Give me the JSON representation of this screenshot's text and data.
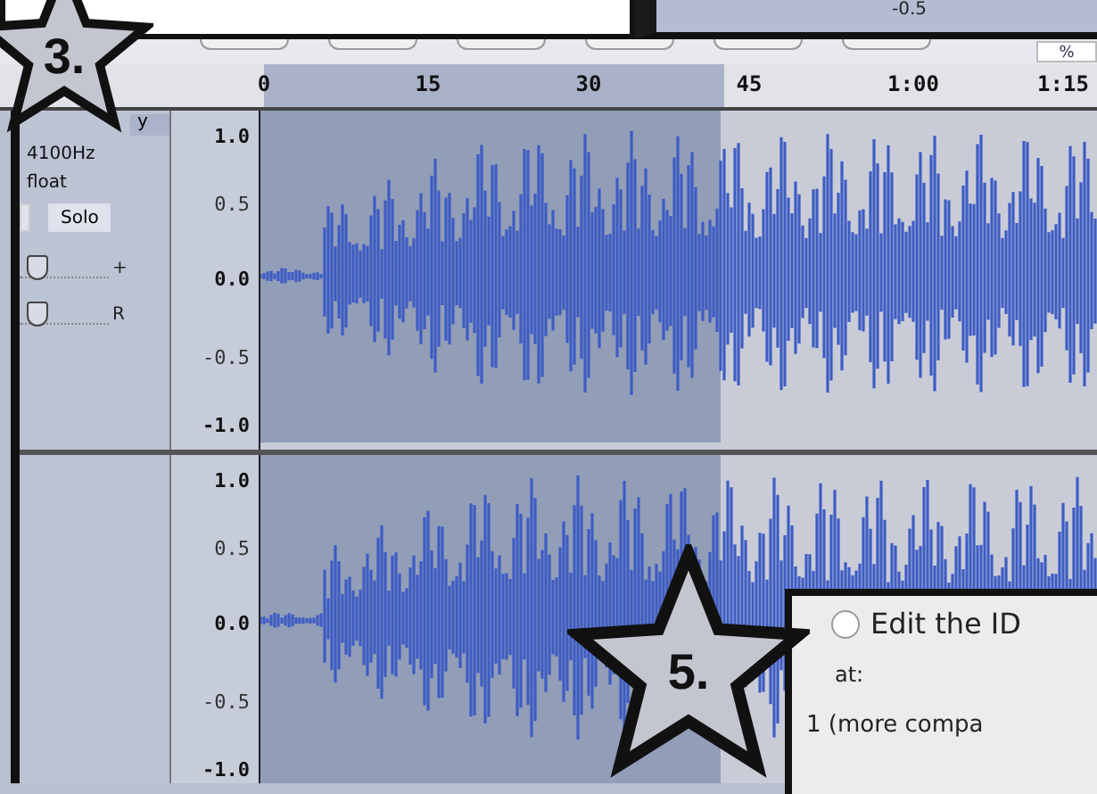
{
  "top_bar": {
    "meter_label": "-0.5",
    "percent_field": "%"
  },
  "ruler": {
    "ticks": [
      "0",
      "15",
      "30",
      "45",
      "1:00",
      "1:15"
    ]
  },
  "tracks": [
    {
      "name": "y",
      "rate": "4100Hz",
      "format": "float",
      "solo_button": "Solo",
      "gain_marker": "+",
      "pan_marker": "R",
      "gain_slider": {
        "level": 0.08
      },
      "pan_slider": {
        "level": 0.08
      },
      "scale": [
        "1.0",
        "0.5",
        "0.0",
        "-0.5",
        "-1.0"
      ]
    },
    {
      "scale": [
        "1.0",
        "0.5",
        "0.0",
        "-0.5",
        "-1.0"
      ]
    }
  ],
  "dialog": {
    "radio": {
      "label": "Edit the ID",
      "selected": false
    },
    "field_label": "at:",
    "option_label": "1 (more compa"
  },
  "callouts": [
    {
      "label": "3."
    },
    {
      "label": "5."
    }
  ]
}
